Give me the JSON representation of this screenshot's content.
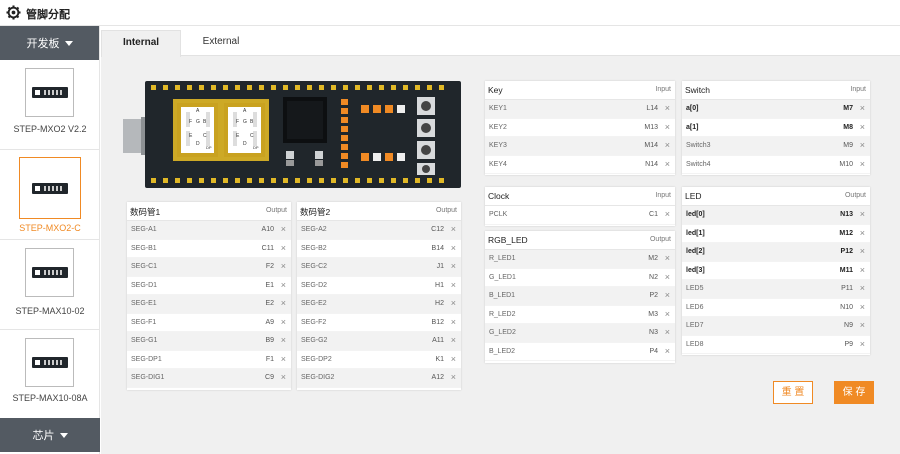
{
  "app": {
    "title": "管脚分配"
  },
  "sidebar": {
    "header_label": "开发板",
    "footer_label": "芯片",
    "boards": [
      {
        "label": "STEP-MXO2 V2.2"
      },
      {
        "label": "STEP-MXO2-C"
      },
      {
        "label": "STEP-MAX10-02"
      },
      {
        "label": "STEP-MAX10-08A"
      }
    ]
  },
  "tabs": [
    {
      "label": "Internal"
    },
    {
      "label": "External"
    }
  ],
  "board_silk": {
    "seg_letters": [
      "A",
      "F",
      "G",
      "B",
      "E",
      "C",
      "D",
      "DP"
    ]
  },
  "panels": {
    "seg1": {
      "title": "数码管1",
      "dir": "Output",
      "rows": [
        {
          "name": "SEG-A1",
          "pin": "A10"
        },
        {
          "name": "SEG-B1",
          "pin": "C11"
        },
        {
          "name": "SEG-C1",
          "pin": "F2"
        },
        {
          "name": "SEG-D1",
          "pin": "E1"
        },
        {
          "name": "SEG-E1",
          "pin": "E2"
        },
        {
          "name": "SEG-F1",
          "pin": "A9"
        },
        {
          "name": "SEG-G1",
          "pin": "B9"
        },
        {
          "name": "SEG-DP1",
          "pin": "F1"
        },
        {
          "name": "SEG-DIG1",
          "pin": "C9"
        }
      ]
    },
    "seg2": {
      "title": "数码管2",
      "dir": "Output",
      "rows": [
        {
          "name": "SEG-A2",
          "pin": "C12"
        },
        {
          "name": "SEG-B2",
          "pin": "B14"
        },
        {
          "name": "SEG-C2",
          "pin": "J1"
        },
        {
          "name": "SEG-D2",
          "pin": "H1"
        },
        {
          "name": "SEG-E2",
          "pin": "H2"
        },
        {
          "name": "SEG-F2",
          "pin": "B12"
        },
        {
          "name": "SEG-G2",
          "pin": "A11"
        },
        {
          "name": "SEG-DP2",
          "pin": "K1"
        },
        {
          "name": "SEG-DIG2",
          "pin": "A12"
        }
      ]
    },
    "key": {
      "title": "Key",
      "dir": "Input",
      "rows": [
        {
          "name": "KEY1",
          "pin": "L14"
        },
        {
          "name": "KEY2",
          "pin": "M13"
        },
        {
          "name": "KEY3",
          "pin": "M14"
        },
        {
          "name": "KEY4",
          "pin": "N14"
        }
      ]
    },
    "switch": {
      "title": "Switch",
      "dir": "Input",
      "rows": [
        {
          "name": "a[0]",
          "pin": "M7",
          "bold": true
        },
        {
          "name": "a[1]",
          "pin": "M8",
          "bold": true
        },
        {
          "name": "Switch3",
          "pin": "M9"
        },
        {
          "name": "Switch4",
          "pin": "M10"
        }
      ]
    },
    "clock": {
      "title": "Clock",
      "dir": "Input",
      "rows": [
        {
          "name": "PCLK",
          "pin": "C1"
        }
      ]
    },
    "rgb": {
      "title": "RGB_LED",
      "dir": "Output",
      "rows": [
        {
          "name": "R_LED1",
          "pin": "M2"
        },
        {
          "name": "G_LED1",
          "pin": "N2"
        },
        {
          "name": "B_LED1",
          "pin": "P2"
        },
        {
          "name": "R_LED2",
          "pin": "M3"
        },
        {
          "name": "G_LED2",
          "pin": "N3"
        },
        {
          "name": "B_LED2",
          "pin": "P4"
        }
      ]
    },
    "led": {
      "title": "LED",
      "dir": "Output",
      "rows": [
        {
          "name": "led[0]",
          "pin": "N13",
          "bold": true
        },
        {
          "name": "led[1]",
          "pin": "M12",
          "bold": true
        },
        {
          "name": "led[2]",
          "pin": "P12",
          "bold": true
        },
        {
          "name": "led[3]",
          "pin": "M11",
          "bold": true
        },
        {
          "name": "LED5",
          "pin": "P11"
        },
        {
          "name": "LED6",
          "pin": "N10"
        },
        {
          "name": "LED7",
          "pin": "N9"
        },
        {
          "name": "LED8",
          "pin": "P9"
        }
      ]
    }
  },
  "remove_glyph": "×",
  "buttons": {
    "reset": "重 置",
    "save": "保 存"
  },
  "colors": {
    "accent": "#f08a24",
    "sidebar_dark": "#535a62",
    "board": "#20262b",
    "pad": "#e0b826"
  }
}
